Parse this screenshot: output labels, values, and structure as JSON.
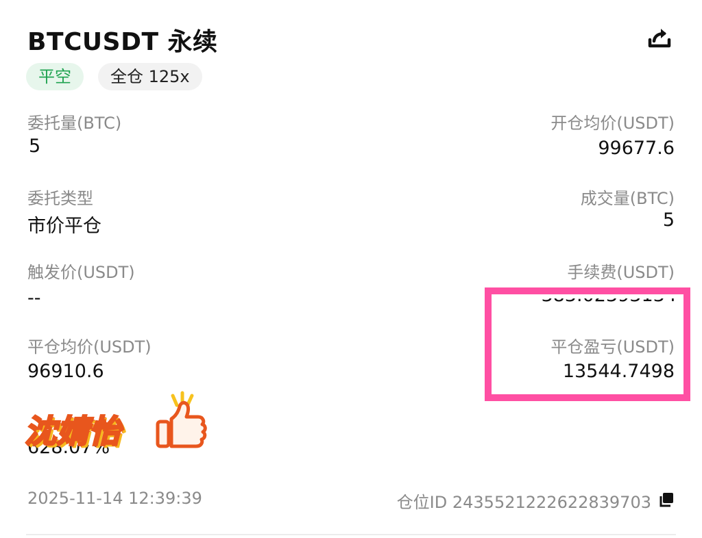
{
  "header": {
    "title": "BTCUSDT 永续",
    "share_icon": "share-icon"
  },
  "tags": {
    "side": "平空",
    "margin": "全仓 125x"
  },
  "fields": {
    "order_qty_label": "委托量(BTC)",
    "order_qty_value": "5",
    "open_avg_label": "开仓均价(USDT)",
    "open_avg_value": "99677.6",
    "order_type_label": "委托类型",
    "order_type_value": "市价平仓",
    "filled_label": "成交量(BTC)",
    "filled_value": "5",
    "trigger_label": "触发价(USDT)",
    "trigger_value": "--",
    "fee_label": "手续费(USDT)",
    "fee_value": "383.02393134",
    "close_avg_label": "平仓均价(USDT)",
    "close_avg_value": "96910.6",
    "pnl_label": "平仓盈亏(USDT)",
    "pnl_value": "13544.7498",
    "roi_value": "628.07%"
  },
  "overlay": {
    "sticker_text": "沈婧怡",
    "highlight_color": "#ff4fa3"
  },
  "footer": {
    "timestamp": "2025-11-14 12:39:39",
    "position_id": "仓位ID 2435521222622839703",
    "copy_icon": "copy-icon"
  },
  "colors": {
    "accent_green": "#1fa350",
    "label_gray": "#8a8a8a",
    "text": "#111111"
  }
}
